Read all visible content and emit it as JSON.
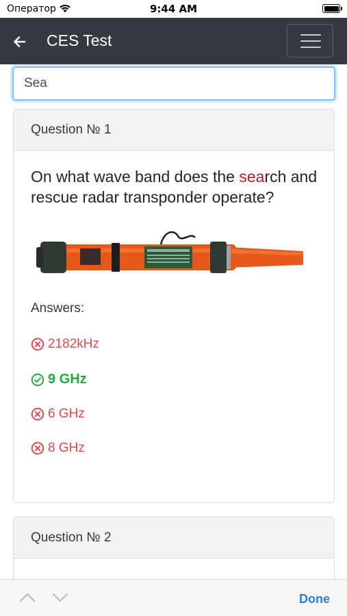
{
  "status_bar": {
    "carrier": "Оператор",
    "time": "9:44 AM"
  },
  "navbar": {
    "title": "CES Test"
  },
  "search": {
    "value": "Sea"
  },
  "questions": [
    {
      "header": "Question № 1",
      "text_before": "On what wave band does the ",
      "text_highlight": "sea",
      "text_after": "rch and rescue radar transponder operate?",
      "answers_label": "Answers:",
      "answers": [
        {
          "text": "2182kHz",
          "correct": false
        },
        {
          "text": "9 GHz",
          "correct": true
        },
        {
          "text": "6 GHz",
          "correct": false
        },
        {
          "text": "8 GHz",
          "correct": false
        }
      ]
    },
    {
      "header": "Question № 2"
    }
  ],
  "keyboard_toolbar": {
    "done_label": "Done"
  },
  "colors": {
    "navbar": "#343a40",
    "highlight": "#b2202a",
    "correct": "#28a745",
    "wrong": "#dc4a50",
    "done": "#2b7fd8"
  }
}
